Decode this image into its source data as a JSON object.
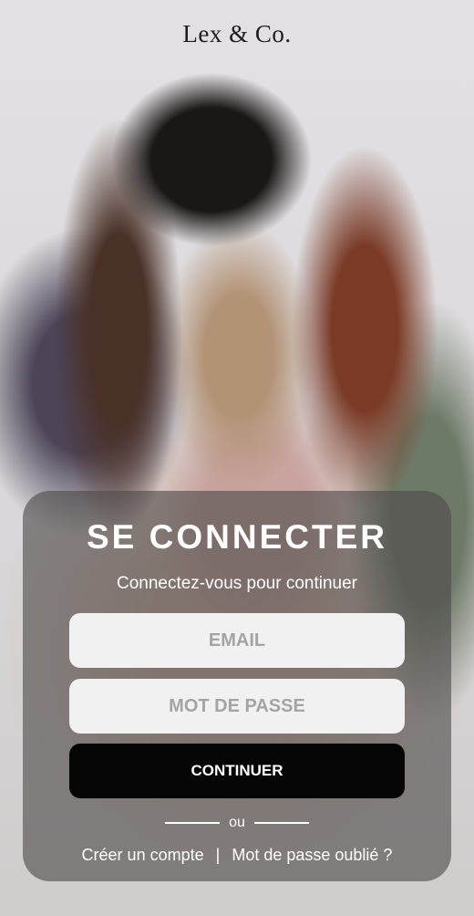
{
  "brand": {
    "name": "Lex & Co."
  },
  "login": {
    "title": "SE CONNECTER",
    "subtitle": "Connectez-vous pour continuer",
    "email_placeholder": "EMAIL",
    "password_placeholder": "MOT DE PASSE",
    "continue_label": "CONTINUER",
    "divider_text": "ou",
    "create_account_label": "Créer un compte",
    "separator": "|",
    "forgot_password_label": "Mot de passe oublié ?"
  },
  "colors": {
    "card_overlay": "#4e4a4a",
    "button_bg": "#050505",
    "field_bg": "#f2f1f1",
    "text_light": "#ffffff"
  }
}
